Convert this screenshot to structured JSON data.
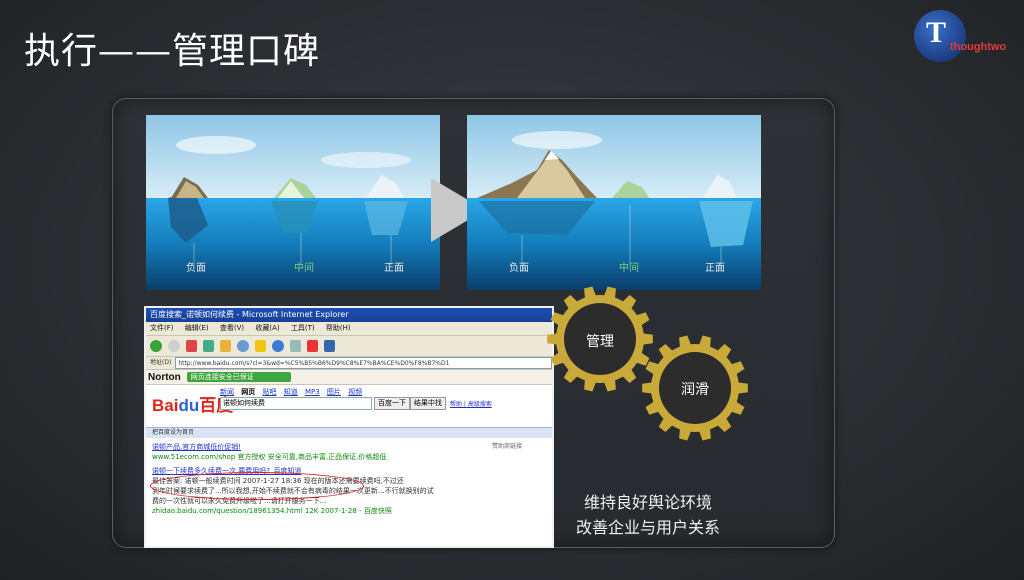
{
  "slide": {
    "title": "执行——管理口碑"
  },
  "logo": {
    "mark": "T",
    "text": "thoughtwo"
  },
  "iceberg_left": {
    "labels": [
      "负面",
      "中间",
      "正面"
    ]
  },
  "iceberg_right": {
    "labels": [
      "负面",
      "中间",
      "正面"
    ]
  },
  "browser": {
    "window_title": "百度搜索_诺顿如何续费 - Microsoft Internet Explorer",
    "menu": [
      "文件(F)",
      "编辑(E)",
      "查看(V)",
      "收藏(A)",
      "工具(T)",
      "帮助(H)"
    ],
    "address_label": "地址(D)",
    "address_url": "http://www.baidu.com/s?cl=3&wd=%C5%B5%B6%D9%C8%E7%BA%CE%D0%F8%B7%D1",
    "norton_brand": "Norton",
    "norton_status": "网页连接安全已保证",
    "baidu_tabs": [
      "新闻",
      "网页",
      "贴吧",
      "知道",
      "MP3",
      "图片",
      "视频"
    ],
    "baidu_active_tab": "网页",
    "search_query": "诺顿如何续费",
    "search_button": "百度一下",
    "search_within_button": "结果中找",
    "help_links": "帮助 | 高级搜索",
    "bar_text": "把百度设为首页",
    "results": [
      {
        "title": "诺顿产品,官方商城低价促销!",
        "url": "www.51ecom.com/shop 官方授权 安全可靠,商品丰富,正品保证,价格超低",
        "side": "赞助商链接"
      },
      {
        "title": "诺顿一下续费多久续费一次,要费用吗?_百度知道",
        "text1": "最佳答案: 诺顿一般续费时间 2007-1-27 18:36 现在的版本还需要续费吗,不过还",
        "text2": "到年时候要求续费了...所以我想,开始不续费就不会有病毒的结果一次更新...不行就换别的试",
        "text3": "费的一次性就可以永久免费升级啦了...请打开服务一下...",
        "url": "zhidao.baidu.com/question/18961354.html 12K 2007-1-28 - 百度快照"
      }
    ]
  },
  "gears": {
    "top": "管理",
    "bottom": "润滑"
  },
  "caption": {
    "line1": "维持良好舆论环境",
    "line2": "改善企业与用户关系"
  },
  "colors": {
    "background": "#2b2e32",
    "gear_gold": "#c9a93a",
    "gear_dark": "#2c2c2c",
    "ocean_blue": "#1b8fd6",
    "sky_blue": "#a8d4ec"
  }
}
